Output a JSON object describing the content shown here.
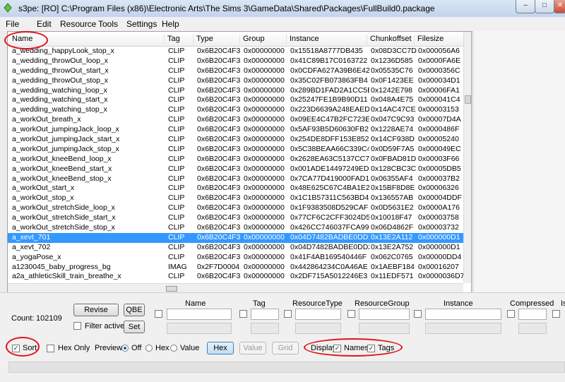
{
  "window": {
    "title": "s3pe: [RO] C:\\Program Files (x86)\\Electronic Arts\\The Sims 3\\GameData\\Shared\\Packages\\FullBuild0.package",
    "icon": "s3pe-app-icon",
    "min": "–",
    "max": "□",
    "close": "✕"
  },
  "menu": [
    "File",
    "Edit",
    "Resource",
    "Tools",
    "Settings",
    "Help"
  ],
  "columns": [
    "Name",
    "Tag",
    "Type",
    "Group",
    "Instance",
    "Chunkoffset",
    "Filesize"
  ],
  "rows": [
    {
      "name": "a_wedding_happyLook_stop_x",
      "tag": "CLIP",
      "type": "0x6B20C4F3",
      "group": "0x00000000",
      "instance": "0x15518A8777DB435",
      "chunk": "0x08D3CC7D",
      "size": "0x000056A6"
    },
    {
      "name": "a_wedding_throwOut_loop_x",
      "tag": "CLIP",
      "type": "0x6B20C4F3",
      "group": "0x00000000",
      "instance": "0x41C89B17C0163722",
      "chunk": "0x1236D585",
      "size": "0x0000FA6E"
    },
    {
      "name": "a_wedding_throwOut_start_x",
      "tag": "CLIP",
      "type": "0x6B20C4F3",
      "group": "0x00000000",
      "instance": "0x0CDFA627A39B6E42",
      "chunk": "0x05535C76",
      "size": "0x0000356C"
    },
    {
      "name": "a_wedding_throwOut_stop_x",
      "tag": "CLIP",
      "type": "0x6B20C4F3",
      "group": "0x00000000",
      "instance": "0x35C02FB073863FB4",
      "chunk": "0x0F1423EE",
      "size": "0x000034D1"
    },
    {
      "name": "a_wedding_watching_loop_x",
      "tag": "CLIP",
      "type": "0x6B20C4F3",
      "group": "0x00000000",
      "instance": "0x289BD1FAD2A1CC5B",
      "chunk": "0x1242E798",
      "size": "0x00006FA1"
    },
    {
      "name": "a_wedding_watching_start_x",
      "tag": "CLIP",
      "type": "0x6B20C4F3",
      "group": "0x00000000",
      "instance": "0x25247FE1B9B90D11",
      "chunk": "0x048A4E75",
      "size": "0x000041C4"
    },
    {
      "name": "a_wedding_watching_stop_x",
      "tag": "CLIP",
      "type": "0x6B20C4F3",
      "group": "0x00000000",
      "instance": "0x223D6639A248EAED",
      "chunk": "0x14AC47CE",
      "size": "0x00003153"
    },
    {
      "name": "a_workOut_breath_x",
      "tag": "CLIP",
      "type": "0x6B20C4F3",
      "group": "0x00000000",
      "instance": "0x09EE4C47B2FC723E",
      "chunk": "0x047C9C93",
      "size": "0x00007D4A"
    },
    {
      "name": "a_workOut_jumpingJack_loop_x",
      "tag": "CLIP",
      "type": "0x6B20C4F3",
      "group": "0x00000000",
      "instance": "0x5AF93B5D60630FB2",
      "chunk": "0x1228AE74",
      "size": "0x0000486F"
    },
    {
      "name": "a_workOut_jumpingJack_start_x",
      "tag": "CLIP",
      "type": "0x6B20C4F3",
      "group": "0x00000000",
      "instance": "0x254DE8DFF153E852",
      "chunk": "0x14CF938D",
      "size": "0x00005240"
    },
    {
      "name": "a_workOut_jumpingJack_stop_x",
      "tag": "CLIP",
      "type": "0x6B20C4F3",
      "group": "0x00000000",
      "instance": "0x5C38BEAA66C339C4",
      "chunk": "0x0D59F7A5",
      "size": "0x000049EC"
    },
    {
      "name": "a_workOut_kneeBend_loop_x",
      "tag": "CLIP",
      "type": "0x6B20C4F3",
      "group": "0x00000000",
      "instance": "0x2628EA63C5137CC7",
      "chunk": "0x0FBAD81D",
      "size": "0x00003F66"
    },
    {
      "name": "a_workOut_kneeBend_start_x",
      "tag": "CLIP",
      "type": "0x6B20C4F3",
      "group": "0x00000000",
      "instance": "0x001ADE14497249ED",
      "chunk": "0x128CBC3C",
      "size": "0x00005DB5"
    },
    {
      "name": "a_workOut_kneeBend_stop_x",
      "tag": "CLIP",
      "type": "0x6B20C4F3",
      "group": "0x00000000",
      "instance": "0x7CA77D419000FAD1",
      "chunk": "0x06355AF4",
      "size": "0x000037B2"
    },
    {
      "name": "a_workOut_start_x",
      "tag": "CLIP",
      "type": "0x6B20C4F3",
      "group": "0x00000000",
      "instance": "0x48E625C67C4BA1E2",
      "chunk": "0x15BF8D8E",
      "size": "0x00006326"
    },
    {
      "name": "a_workOut_stop_x",
      "tag": "CLIP",
      "type": "0x6B20C4F3",
      "group": "0x00000000",
      "instance": "0x1C1B57311C563BD4",
      "chunk": "0x136557AB",
      "size": "0x00004DDF"
    },
    {
      "name": "a_workOut_stretchSide_loop_x",
      "tag": "CLIP",
      "type": "0x6B20C4F3",
      "group": "0x00000000",
      "instance": "0x1F9383508D529CAF",
      "chunk": "0x0D5631E2",
      "size": "0x0000A176"
    },
    {
      "name": "a_workOut_stretchSide_start_x",
      "tag": "CLIP",
      "type": "0x6B20C4F3",
      "group": "0x00000000",
      "instance": "0x77CF6C2CFF3024D5",
      "chunk": "0x10018F47",
      "size": "0x00003758"
    },
    {
      "name": "a_workOut_stretchSide_stop_x",
      "tag": "CLIP",
      "type": "0x6B20C4F3",
      "group": "0x00000000",
      "instance": "0x426CC746037FCA99",
      "chunk": "0x06D4862F",
      "size": "0x00003732"
    },
    {
      "name": "a_xevt_701",
      "tag": "CLIP",
      "type": "0x6B20C4F3",
      "group": "0x00000000",
      "instance": "0x04D7482BADBE0DD1",
      "chunk": "0x13E2A112",
      "size": "0x000000D1",
      "selected": true
    },
    {
      "name": "a_xevt_702",
      "tag": "CLIP",
      "type": "0x6B20C4F3",
      "group": "0x00000000",
      "instance": "0x04D7482BADBE0DD2",
      "chunk": "0x13E2A752",
      "size": "0x000000D1"
    },
    {
      "name": "a_yogaPose_x",
      "tag": "CLIP",
      "type": "0x6B20C4F3",
      "group": "0x00000000",
      "instance": "0x41F4AB169540446F",
      "chunk": "0x062C0765",
      "size": "0x00000DD4"
    },
    {
      "name": "a1230045_baby_progress_bg",
      "tag": "IMAG",
      "type": "0x2F7D0004",
      "group": "0x00000000",
      "instance": "0x442864234C0A46AE",
      "chunk": "0x1AEBF184",
      "size": "0x00016207"
    },
    {
      "name": "a2a_athleticSkill_train_breathe_x",
      "tag": "CLIP",
      "type": "0x6B20C4F3",
      "group": "0x00000000",
      "instance": "0x2DF715A5012246E3",
      "chunk": "0x11EDF571",
      "size": "0x0000036D7"
    }
  ],
  "controls": {
    "count_label": "Count:",
    "count_value": "102109",
    "revise": "Revise",
    "qbe": "QBE",
    "set": "Set",
    "filter_active": "Filter active",
    "sort": "Sort",
    "hex_only": "Hex Only",
    "preview_label": "Preview:",
    "preview_options": [
      "Off",
      "Hex",
      "Value"
    ],
    "preview_selected": "Off",
    "hex_btn": "Hex",
    "value_btn": "Value",
    "grid_btn": "Grid",
    "display_label": "Display:",
    "names": "Names",
    "tags": "Tags",
    "check_mark": "✓",
    "filter_fields": [
      "Name",
      "Tag",
      "ResourceType",
      "ResourceGroup",
      "Instance",
      "Compressed",
      "Is"
    ]
  },
  "highlight_color": "#e0141e",
  "selection_color": "#3399ff"
}
